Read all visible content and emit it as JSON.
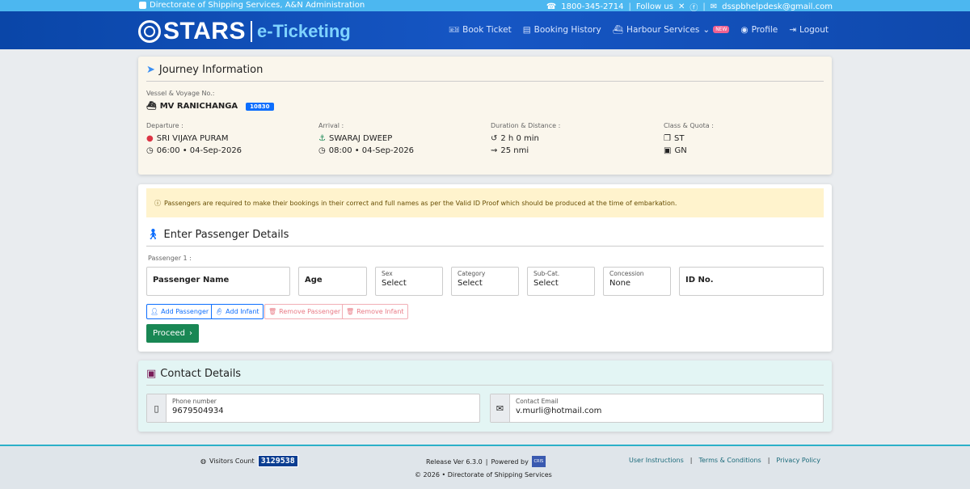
{
  "topbar": {
    "org": "Directorate of Shipping Services, A&N Administration",
    "phone": "1800-345-2714",
    "follow_label": "Follow us",
    "email": "dsspbhelpdesk@gmail.com"
  },
  "brand": {
    "name": "STARS",
    "sub": "e-Ticketing"
  },
  "nav": {
    "book": "Book Ticket",
    "history": "Booking History",
    "harbour": "Harbour Services",
    "harbour_badge": "NEW",
    "profile": "Profile",
    "logout": "Logout"
  },
  "journey": {
    "title": "Journey Information",
    "vessel_label": "Vessel & Voyage No.:",
    "vessel": "MV RANICHANGA",
    "voyage_no": "10830",
    "departure_label": "Departure :",
    "departure_place": "SRI VIJAYA PURAM",
    "departure_time": "06:00 • 04-Sep-2026",
    "arrival_label": "Arrival :",
    "arrival_place": "SWARAJ DWEEP",
    "arrival_time": "08:00 • 04-Sep-2026",
    "duration_label": "Duration & Distance :",
    "duration": "2 h 0 min",
    "distance": "25 nmi",
    "class_label": "Class & Quota :",
    "class": "ST",
    "quota": "GN"
  },
  "passenger": {
    "alert": "Passengers are required to make their bookings in their correct and full names as per the Valid ID Proof which should be produced at the time of embarkation.",
    "title": "Enter Passenger Details",
    "p1_label": "Passenger 1 :",
    "name_placeholder": "Passenger Name",
    "age_placeholder": "Age",
    "sex_label": "Sex",
    "sex_value": "Select",
    "category_label": "Category",
    "category_value": "Select",
    "subcat_label": "Sub-Cat.",
    "subcat_value": "Select",
    "concession_label": "Concession",
    "concession_value": "None",
    "idno_placeholder": "ID No.",
    "add_passenger": "Add Passenger",
    "add_infant": "Add Infant",
    "remove_passenger": "Remove Passenger",
    "remove_infant": "Remove Infant",
    "proceed": "Proceed"
  },
  "contact": {
    "title": "Contact Details",
    "phone_label": "Phone number",
    "phone": "9679504934",
    "email_label": "Contact Email",
    "email": "v.murli@hotmail.com"
  },
  "footer": {
    "visitors_label": "Visitors Count",
    "visitors_count": "3129538",
    "release": "Release Ver 6.3.0",
    "powered": "Powered by",
    "cris_logo": "CRIS",
    "copyright": "© 2026 • Directorate of Shipping Services",
    "instructions": "User Instructions",
    "terms": "Terms & Conditions",
    "privacy": "Privacy Policy"
  },
  "colors": {
    "navbar": "#1656c4",
    "topbar": "#4cb7f0",
    "proceed": "#198754",
    "primary": "#0d6efd"
  }
}
